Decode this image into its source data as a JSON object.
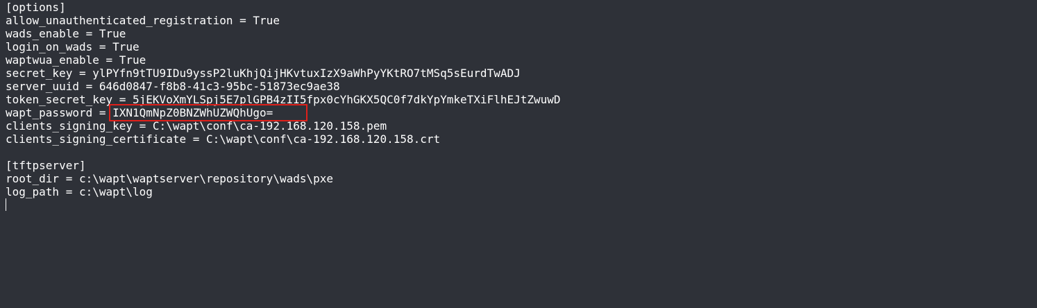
{
  "terminal": {
    "lines": [
      "[options]",
      "allow_unauthenticated_registration = True",
      "wads_enable = True",
      "login_on_wads = True",
      "waptwua_enable = True",
      "secret_key = ylPYfn9tTU9IDu9yssP2luKhjQijHKvtuxIzX9aWhPyYKtRO7tMSq5sEurdTwADJ",
      "server_uuid = 646d0847-f8b8-41c3-95bc-51873ec9ae38",
      "token_secret_key = 5jEKVoXmYLSpj5E7plGPB4zII5fpx0cYhGKX5QC0f7dkYpYmkeTXiFlhEJtZwuwD",
      "wapt_password = IXN1QmNpZ0BNZWhUZWQhUgo=",
      "clients_signing_key = C:\\wapt\\conf\\ca-192.168.120.158.pem",
      "clients_signing_certificate = C:\\wapt\\conf\\ca-192.168.120.158.crt",
      "",
      "[tftpserver]",
      "root_dir = c:\\wapt\\waptserver\\repository\\wads\\pxe",
      "log_path = c:\\wapt\\log"
    ]
  },
  "colors": {
    "background": "#2e3138",
    "text": "#ffffff",
    "highlight_border": "#e0201a"
  }
}
